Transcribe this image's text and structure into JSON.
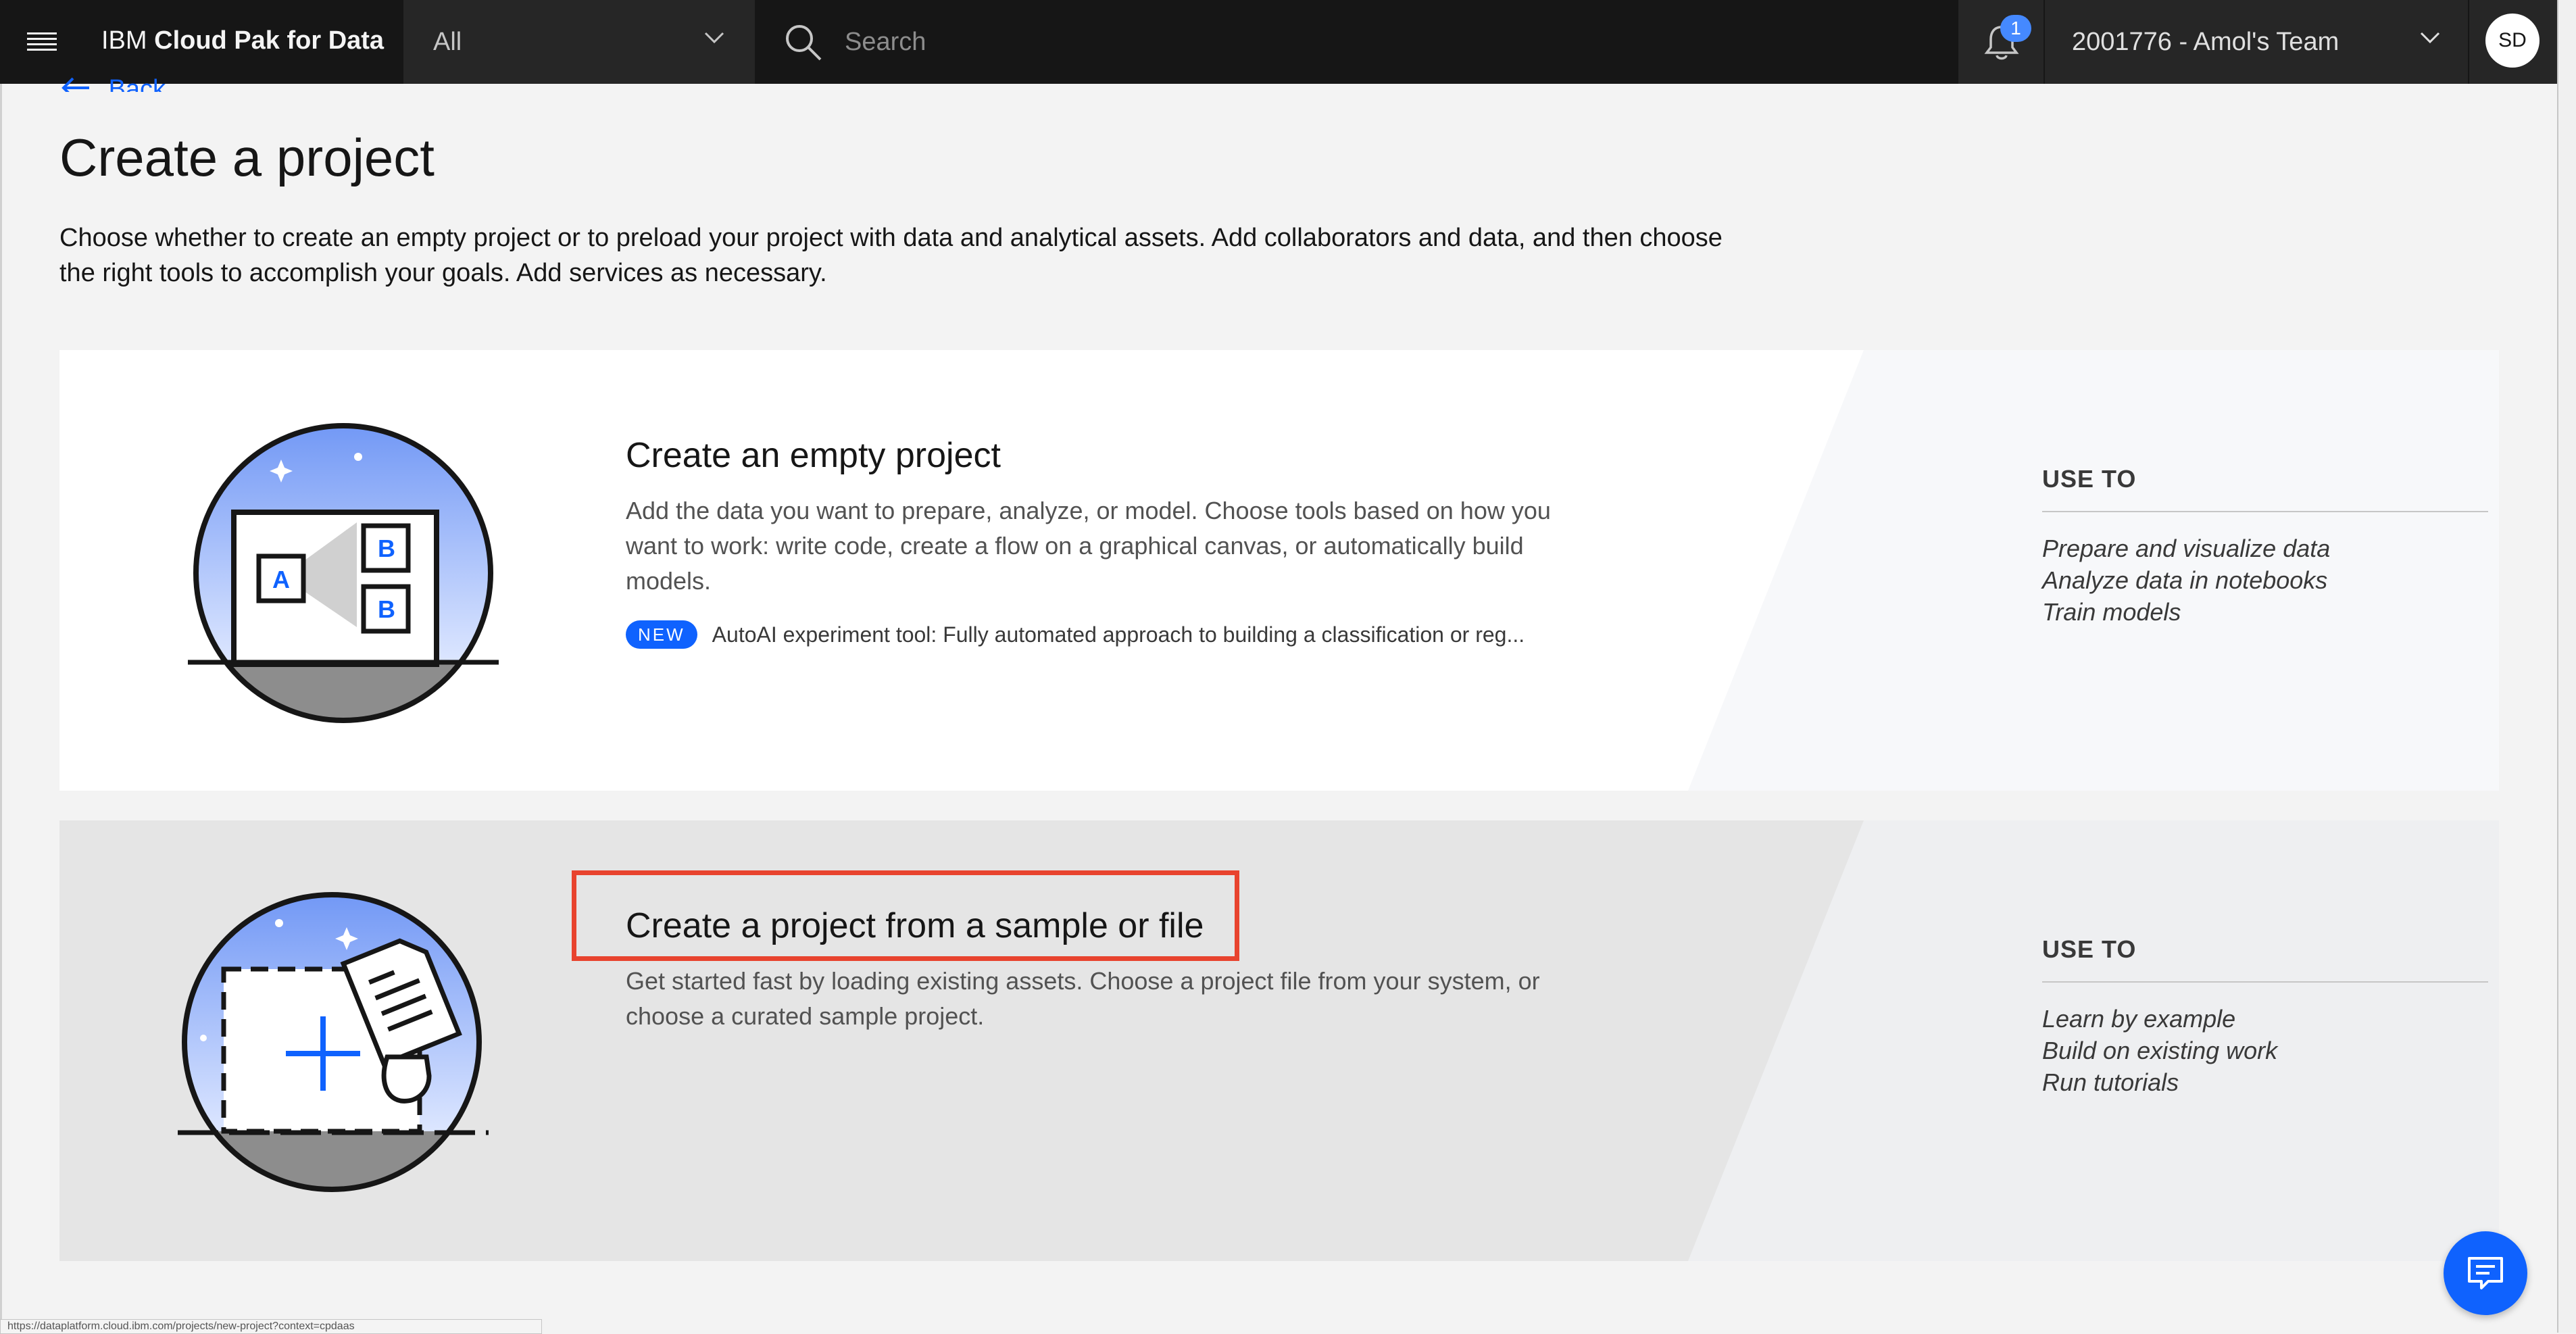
{
  "header": {
    "brand_prefix": "IBM",
    "brand_name": "Cloud Pak for Data",
    "scope_label": "All",
    "search_placeholder": "Search",
    "notification_count": "1",
    "account_label": "2001776 - Amol's Team",
    "avatar_initials": "SD"
  },
  "nav": {
    "back_label": "Back"
  },
  "page": {
    "title": "Create a project",
    "description": "Choose whether to create an empty project or to preload your project with data and analytical assets. Add collaborators and data, and then choose the right tools to accomplish your goals. Add services as necessary."
  },
  "cards": {
    "empty": {
      "title": "Create an empty project",
      "description": "Add the data you want to prepare, analyze, or model. Choose tools based on how you want to work: write code, create a flow on a graphical canvas, or automatically build models.",
      "new_tag": "NEW",
      "new_text": "AutoAI experiment tool: Fully automated approach to building a classification or reg...",
      "use_to_heading": "USE TO",
      "use_to_items": [
        "Prepare and visualize data",
        "Analyze data in notebooks",
        "Train models"
      ]
    },
    "sample": {
      "title": "Create a project from a sample or file",
      "description": "Get started fast by loading existing assets. Choose a project file from your system, or choose a curated sample project.",
      "use_to_heading": "USE TO",
      "use_to_items": [
        "Learn by example",
        "Build on existing work",
        "Run tutorials"
      ]
    }
  },
  "status_bar": {
    "url": "https://dataplatform.cloud.ibm.com/projects/new-project?context=cpdaas"
  },
  "colors": {
    "topbar": "#161616",
    "accent": "#0f62fe",
    "highlight": "#e8432e"
  },
  "icons": [
    "hamburger-menu-icon",
    "chevron-down-icon",
    "search-icon",
    "notification-bell-icon",
    "arrow-left-icon",
    "chat-icon"
  ]
}
